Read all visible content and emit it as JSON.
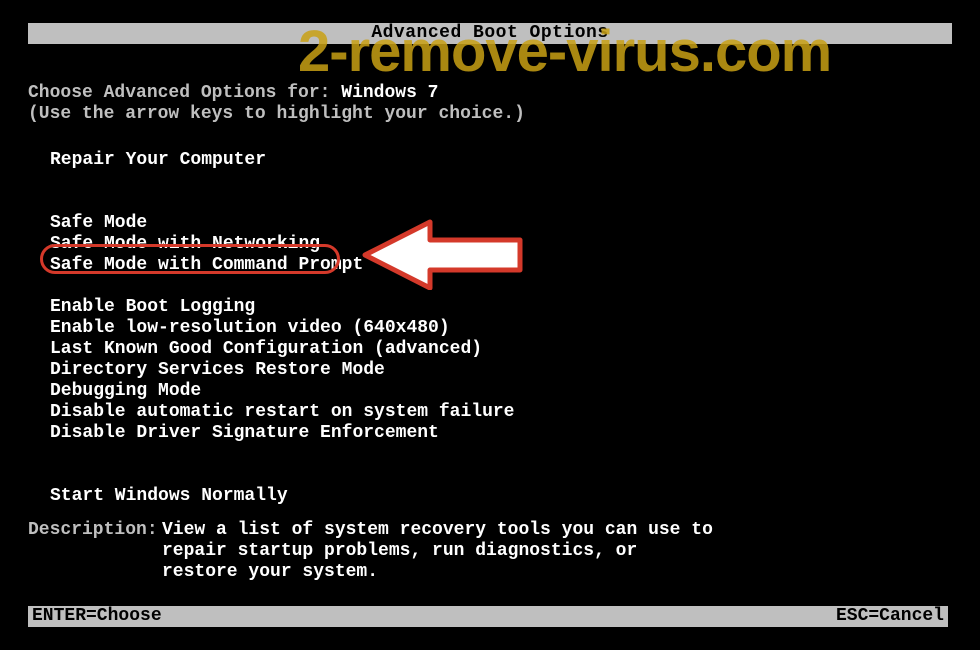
{
  "title": "Advanced Boot Options",
  "watermark": "2-remove-virus.com",
  "prompt": {
    "prefix": "Choose Advanced Options for: ",
    "os": "Windows 7"
  },
  "hint": "(Use the arrow keys to highlight your choice.)",
  "menu": {
    "group1": [
      "Repair Your Computer"
    ],
    "group2": [
      "Safe Mode",
      "Safe Mode with Networking",
      "Safe Mode with Command Prompt"
    ],
    "group3": [
      "Enable Boot Logging",
      "Enable low-resolution video (640x480)",
      "Last Known Good Configuration (advanced)",
      "Directory Services Restore Mode",
      "Debugging Mode",
      "Disable automatic restart on system failure",
      "Disable Driver Signature Enforcement"
    ],
    "group4": [
      "Start Windows Normally"
    ],
    "highlighted_index": 2
  },
  "description": {
    "label": "Description:",
    "text": "View a list of system recovery tools you can use to repair startup problems, run diagnostics, or restore your system."
  },
  "footer": {
    "left": "ENTER=Choose",
    "right": "ESC=Cancel"
  }
}
